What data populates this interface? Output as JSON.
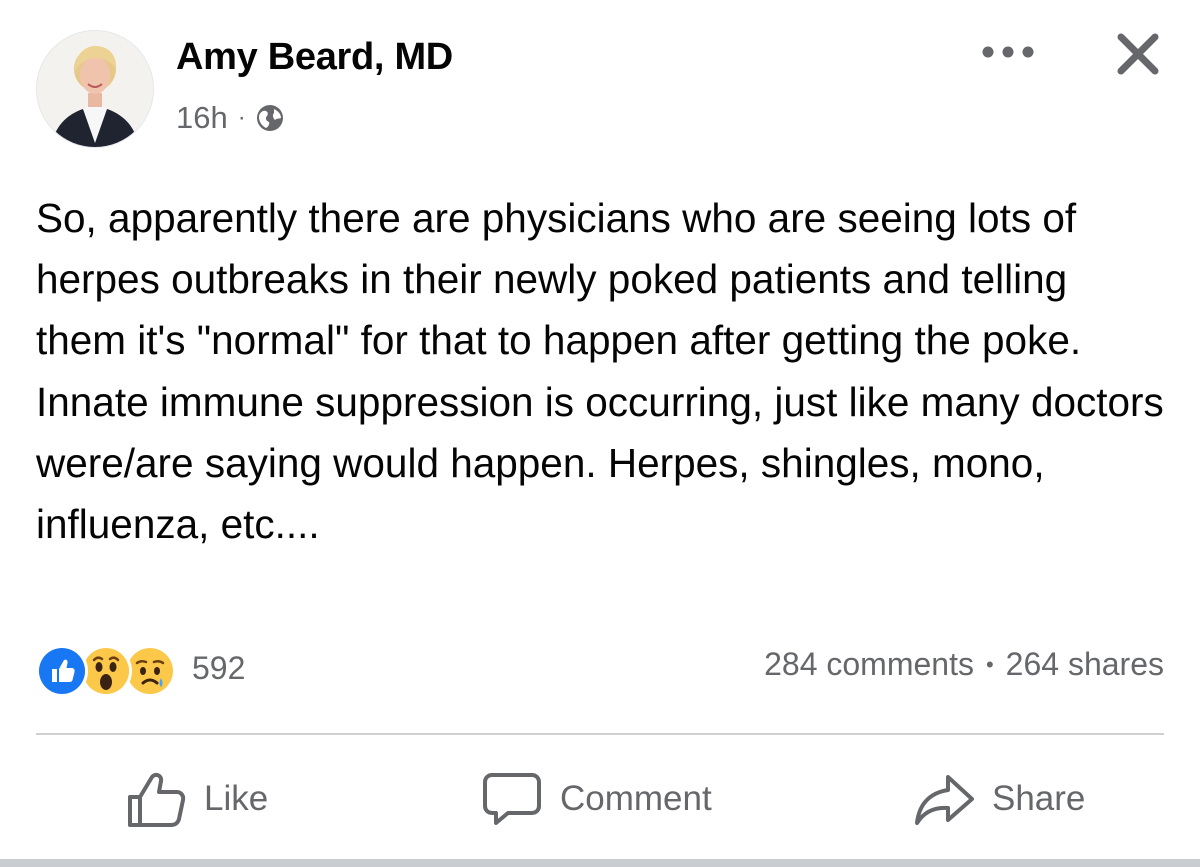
{
  "post": {
    "author": "Amy Beard, MD",
    "time": "16h",
    "meta_separator": "·",
    "privacy_icon": "globe-icon",
    "avatar_icon": "profile-photo",
    "more_icon": "more-options-icon",
    "close_icon": "close-icon",
    "text": "So, apparently there are physicians who are seeing lots of herpes outbreaks in their newly poked patients and telling them it's \"normal\" for that to happen after getting the poke. Innate immune suppression is occurring, just like many doctors were/are saying would happen. Herpes, shingles, mono, influenza, etc...."
  },
  "reactions": {
    "icons": [
      "like-reaction-icon",
      "wow-reaction-icon",
      "sad-reaction-icon"
    ],
    "count": "592"
  },
  "stats": {
    "comments": "284 comments",
    "separator": "•",
    "shares": "264 shares"
  },
  "actions": {
    "like_label": "Like",
    "comment_label": "Comment",
    "share_label": "Share"
  },
  "colors": {
    "text": "#050505",
    "secondary_text": "#65676b",
    "like_blue": "#1877f2",
    "reaction_yellow": "#fcc84a",
    "divider": "#ced0d4"
  }
}
